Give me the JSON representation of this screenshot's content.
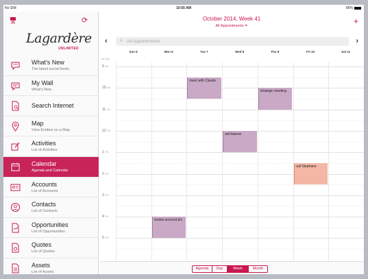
{
  "status_bar": {
    "carrier": "No SIM",
    "time": "10:55 AM",
    "battery": "86%"
  },
  "sidebar": {
    "logo": "Lagardère",
    "logo_sub": "UNLIMITED",
    "items": [
      {
        "title": "What's New",
        "subtitle": "The latest social feeds",
        "icon": "chat-bubble-icon"
      },
      {
        "title": "My Wall",
        "subtitle": "What's New",
        "icon": "wall-icon"
      },
      {
        "title": "Search Internet",
        "subtitle": "",
        "icon": "search-doc-icon"
      },
      {
        "title": "Map",
        "subtitle": "View Entities on a Map",
        "icon": "map-pin-icon"
      },
      {
        "title": "Activities",
        "subtitle": "List of Activities",
        "icon": "activities-icon"
      },
      {
        "title": "Calendar",
        "subtitle": "Agenda and Calendar",
        "icon": "calendar-icon",
        "active": true
      },
      {
        "title": "Accounts",
        "subtitle": "List of Accounts",
        "icon": "accounts-icon"
      },
      {
        "title": "Contacts",
        "subtitle": "List of Contacts",
        "icon": "contacts-icon"
      },
      {
        "title": "Opportunities",
        "subtitle": "List of Opportunities",
        "icon": "opportunities-icon"
      },
      {
        "title": "Quotes",
        "subtitle": "List of Quotes",
        "icon": "quotes-icon"
      },
      {
        "title": "Assets",
        "subtitle": "List of Assets",
        "icon": "assets-icon"
      }
    ]
  },
  "header": {
    "title": "October 2014, Week 41",
    "subtitle": "All Appointments"
  },
  "search": {
    "placeholder": "All Appointments"
  },
  "week": {
    "days": [
      "Sun 5",
      "Mon 6",
      "Tue 7",
      "Wed 8",
      "Thu 9",
      "Fri 10",
      "Sat 11"
    ],
    "all_day_label": "all-day",
    "hours": [
      {
        "h": "9",
        "ampm": "AM"
      },
      {
        "h": "10",
        "ampm": "AM"
      },
      {
        "h": "11",
        "ampm": "AM"
      },
      {
        "h": "12",
        "ampm": "PM"
      },
      {
        "h": "1",
        "ampm": "PM"
      },
      {
        "h": "2",
        "ampm": "PM"
      },
      {
        "h": "3",
        "ampm": "PM"
      },
      {
        "h": "4",
        "ampm": "PM"
      },
      {
        "h": "5",
        "ampm": "PM"
      }
    ],
    "events": [
      {
        "title": "meet with Claude",
        "day": 2,
        "start": 9.5,
        "end": 10.5,
        "color": "#c9a9c5"
      },
      {
        "title": "strategic meeting",
        "day": 4,
        "start": 10.0,
        "end": 11.0,
        "color": "#c9a9c5"
      },
      {
        "title": "sell banner",
        "day": 3,
        "start": 12.0,
        "end": 13.0,
        "color": "#c9a9c5"
      },
      {
        "title": "call Stephane",
        "day": 5,
        "start": 13.5,
        "end": 14.5,
        "color": "#f4b7a5"
      },
      {
        "title": "review account pls",
        "day": 1,
        "start": 16.0,
        "end": 17.0,
        "color": "#c9a9c5"
      }
    ]
  },
  "view_switch": {
    "options": [
      "Agenda",
      "Day",
      "Week",
      "Month"
    ],
    "selected": "Week"
  },
  "colors": {
    "accent": "#c8174f",
    "sidebar_active": "#c8245a"
  }
}
